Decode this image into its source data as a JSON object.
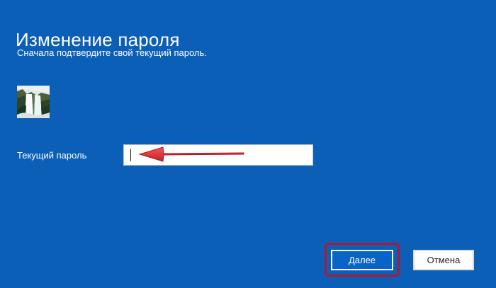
{
  "page": {
    "title": "Изменение пароля",
    "subtitle": "Сначала подтвердите свой текущий пароль."
  },
  "user": {
    "avatar_icon": "waterfall-photo-icon"
  },
  "form": {
    "current_password_label": "Текущий пароль",
    "current_password_value": ""
  },
  "annotations": {
    "arrow_icon": "red-arrow-icon",
    "highlight_color": "#b11730"
  },
  "buttons": {
    "next_label": "Далее",
    "cancel_label": "Отмена"
  },
  "colors": {
    "background": "#0b5fb7",
    "primary_button": "#0a63c7",
    "arrow": "#d9242d"
  }
}
